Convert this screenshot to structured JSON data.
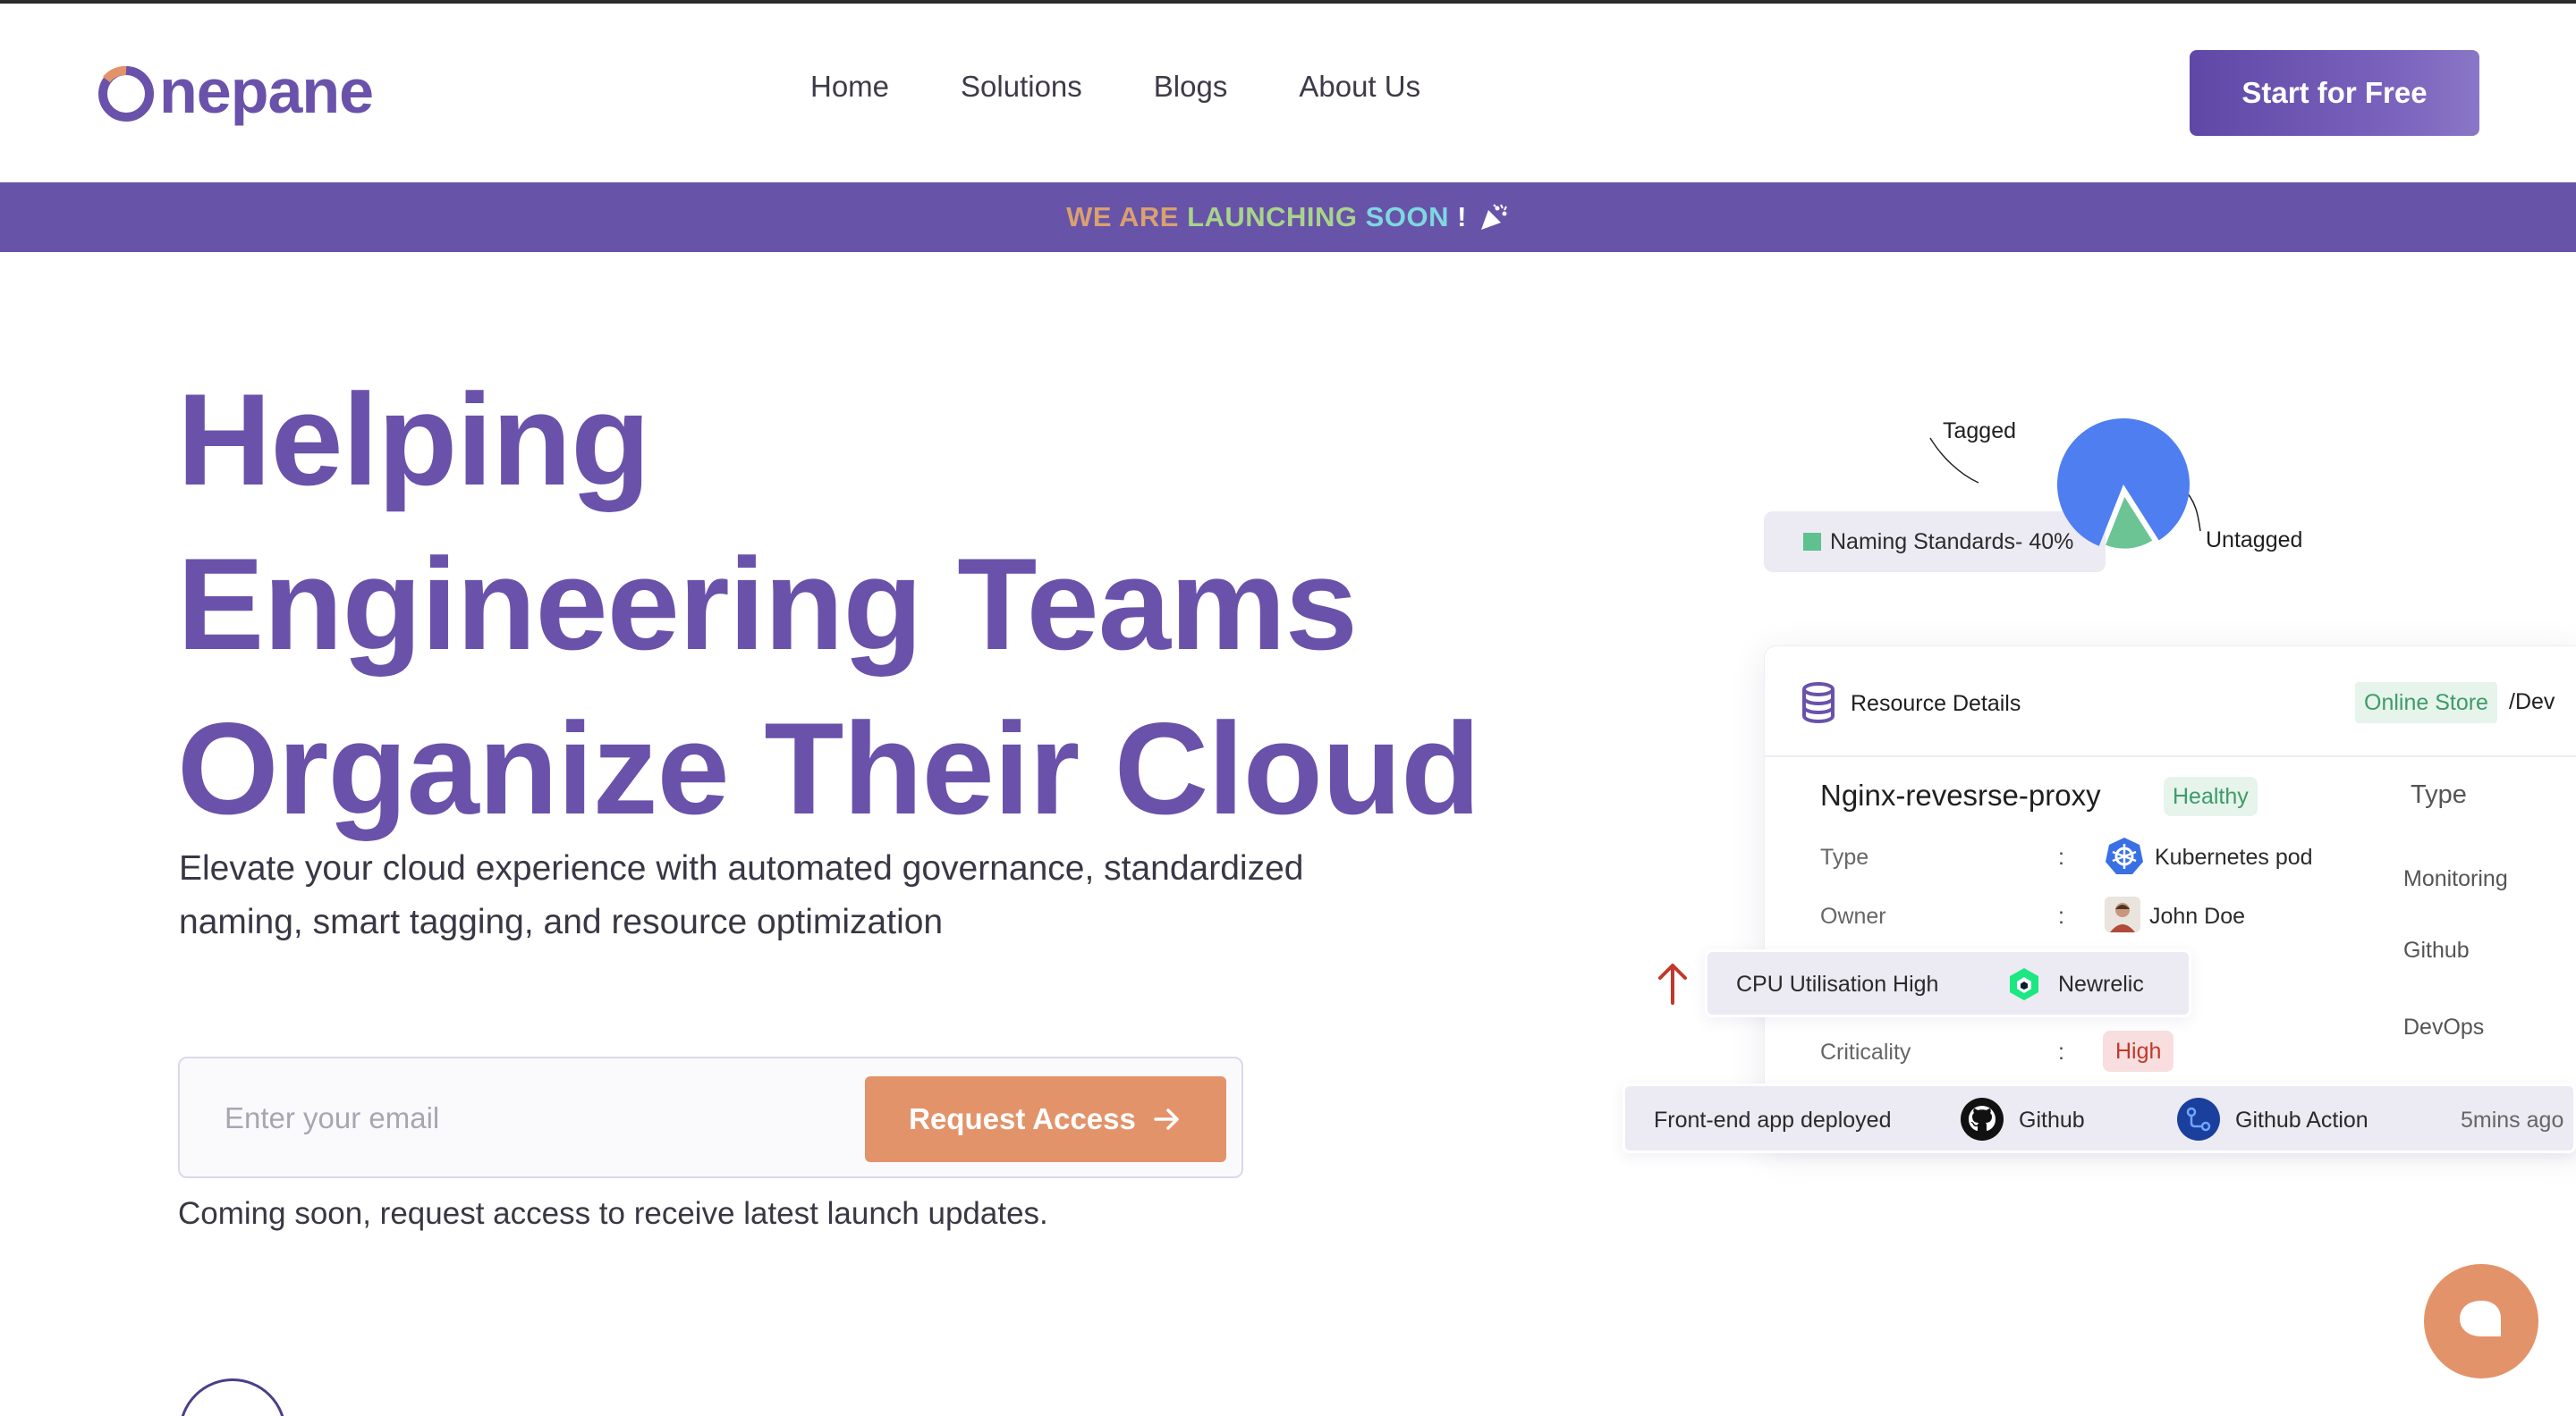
{
  "brand": {
    "name": "nepane",
    "logo_letter": "O"
  },
  "nav": {
    "items": [
      "Home",
      "Solutions",
      "Blogs",
      "About Us"
    ],
    "cta": "Start for Free"
  },
  "banner": {
    "part1": "WE ARE ",
    "part2": "LAUNCHING ",
    "part3": "SOON",
    "part4": " !",
    "icon": "party-popper-icon"
  },
  "hero": {
    "title_lines": [
      "Helping",
      "Engineering Teams",
      "Organize Their Cloud"
    ],
    "subtitle": "Elevate your cloud experience with automated governance, standardized naming, smart tagging, and resource optimization",
    "email_placeholder": "Enter your email",
    "request_button": "Request Access",
    "coming_soon": "Coming soon, request access to receive latest launch updates."
  },
  "illustration": {
    "pie": {
      "tagged_label": "Tagged",
      "untagged_label": "Untagged",
      "tagged_fraction": 0.15,
      "colors": {
        "tagged": "#6cc494",
        "untagged": "#4f7ef0"
      }
    },
    "naming_pill": "Naming Standards- 40%",
    "resource_card": {
      "title": "Resource Details",
      "env_tag": "Online Store",
      "env_suffix": "/Dev",
      "resource_name": "Nginx-revesrse-proxy",
      "status": "Healthy",
      "type_header": "Type",
      "rows": [
        {
          "label": "Type",
          "value": "Kubernetes pod"
        },
        {
          "label": "Owner",
          "value": "John Doe"
        },
        {
          "label": "Criticality",
          "value": "High"
        }
      ],
      "side_items": [
        "Monitoring",
        "Github",
        "DevOps"
      ],
      "colon": ":"
    },
    "cpu_alert": {
      "text": "CPU Utilisation High",
      "source": "Newrelic"
    },
    "deploy_event": {
      "text": "Front-end app deployed",
      "source": "Github",
      "pipeline": "Github Action",
      "time": "5mins ago"
    }
  },
  "colors": {
    "brand_purple": "#6a52ab",
    "accent_orange": "#e3936a",
    "banner_bg": "#6753a8"
  }
}
